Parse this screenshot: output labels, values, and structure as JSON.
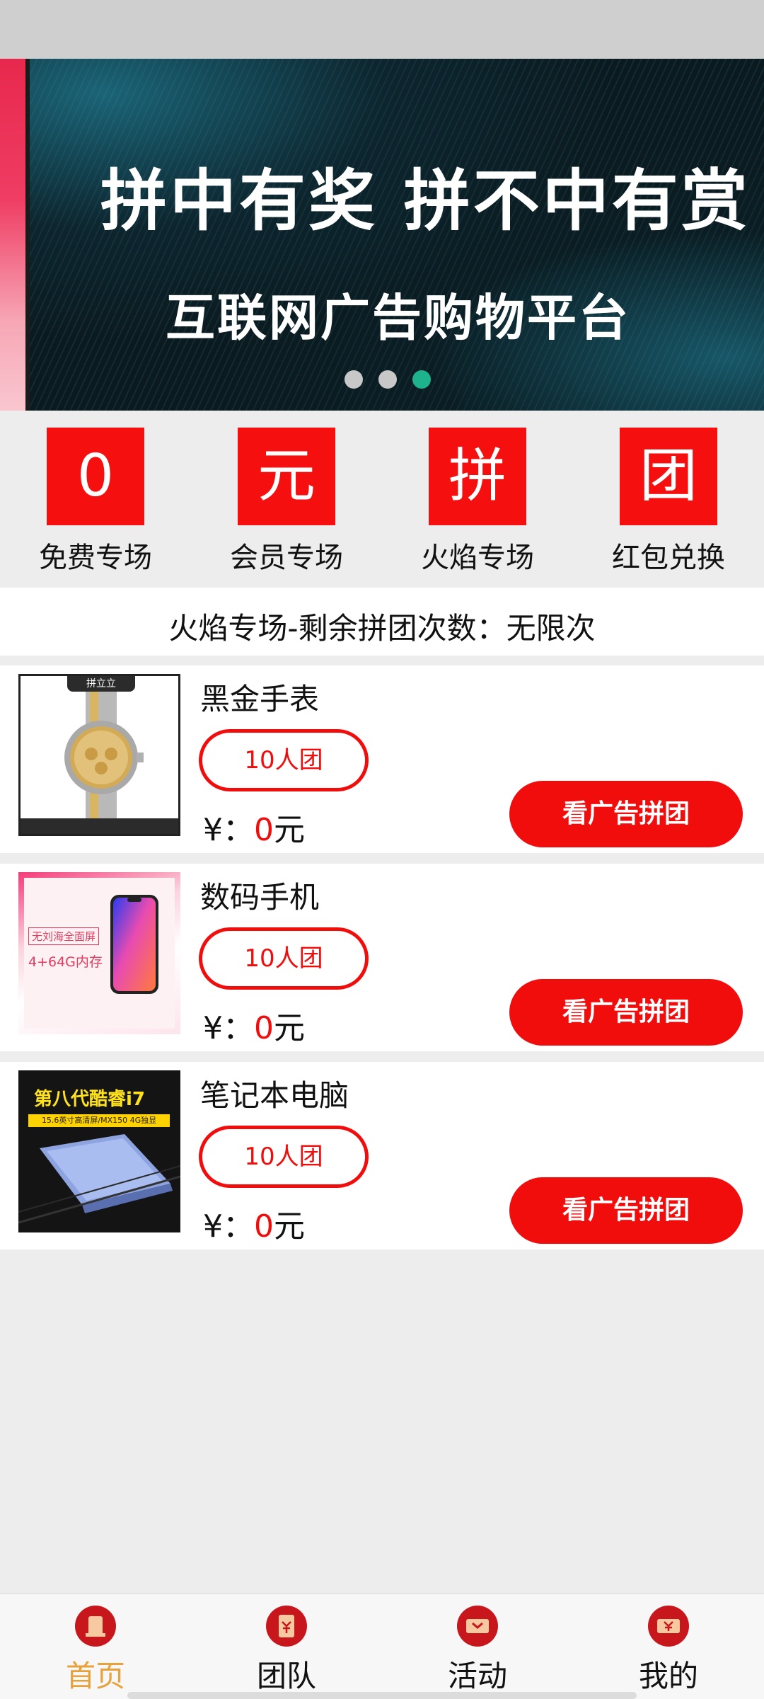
{
  "banner": {
    "title": "拼中有奖  拼不中有赏",
    "subtitle": "互联网广告购物平台",
    "dots": 3,
    "active_dot": 3,
    "accent_color": "#1db38d"
  },
  "categories": [
    {
      "icon_char": "0",
      "label": "免费专场"
    },
    {
      "icon_char": "元",
      "label": "会员专场"
    },
    {
      "icon_char": "拼",
      "label": "火焰专场"
    },
    {
      "icon_char": "团",
      "label": "红包兑换"
    }
  ],
  "info": {
    "text": "火焰专场-剩余拼团次数：无限次"
  },
  "products": [
    {
      "name": "黑金手表",
      "group_label": "10人团",
      "price_prefix": "¥：",
      "price_value": "0",
      "price_unit": "元",
      "button_label": "看广告拼团",
      "thumb_tag": "拼立立"
    },
    {
      "name": "数码手机",
      "group_label": "10人团",
      "price_prefix": "¥：",
      "price_value": "0",
      "price_unit": "元",
      "button_label": "看广告拼团",
      "thumb_text_1": "无刘海全面屏",
      "thumb_text_2": "4+64G内存"
    },
    {
      "name": "笔记本电脑",
      "group_label": "10人团",
      "price_prefix": "¥：",
      "price_value": "0",
      "price_unit": "元",
      "button_label": "看广告拼团",
      "thumb_text_1": "第八代酷睿i7",
      "thumb_text_2": "15.6英寸高清屏/MX150 4G独显"
    }
  ],
  "bottom_nav": [
    {
      "label": "首页",
      "icon": "home-icon",
      "active": true
    },
    {
      "label": "团队",
      "icon": "team-icon",
      "active": false
    },
    {
      "label": "活动",
      "icon": "activity-icon",
      "active": false
    },
    {
      "label": "我的",
      "icon": "profile-icon",
      "active": false
    }
  ],
  "colors": {
    "primary_red": "#f20d0d",
    "active_nav": "#e8a23c",
    "nav_icon_red": "#c8161d"
  }
}
